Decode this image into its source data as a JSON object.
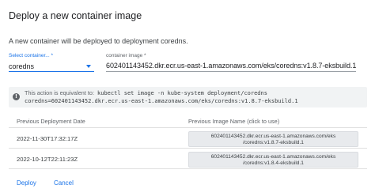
{
  "dialog": {
    "title": "Deploy a new container image",
    "description": "A new container will be deployed to deployment coredns."
  },
  "select_container": {
    "label": "Select container... *",
    "value": "coredns"
  },
  "image_field": {
    "label": "container image *",
    "value": "602401143452.dkr.ecr.us-east-1.amazonaws.com/eks/coredns:v1.8.7-eksbuild.1"
  },
  "info": {
    "text": "This action is equivalent to:",
    "command_line1": "kubectl set image -n kube-system deployment/coredns",
    "command_line2": "coredns=602401143452.dkr.ecr.us-east-1.amazonaws.com/eks/coredns:v1.8.7-eksbuild.1"
  },
  "history": {
    "headers": [
      "Previous Deployment Date",
      "Previous Image Name (click to use)"
    ],
    "rows": [
      {
        "date": "2022-11-30T17:32:17Z",
        "image_line1": "602401143452.dkr.ecr.us-east-1.amazonaws.com/eks",
        "image_line2": "/coredns:v1.8.7-eksbuild.1"
      },
      {
        "date": "2022-10-12T22:11:23Z",
        "image_line1": "602401143452.dkr.ecr.us-east-1.amazonaws.com/eks",
        "image_line2": "/coredns:v1.8.4-eksbuild.1"
      }
    ]
  },
  "actions": {
    "deploy": "Deploy",
    "cancel": "Cancel"
  },
  "colors": {
    "accent": "#1a73e8",
    "info_background": "#f1f3f4",
    "chip_background": "#e8eaed"
  }
}
